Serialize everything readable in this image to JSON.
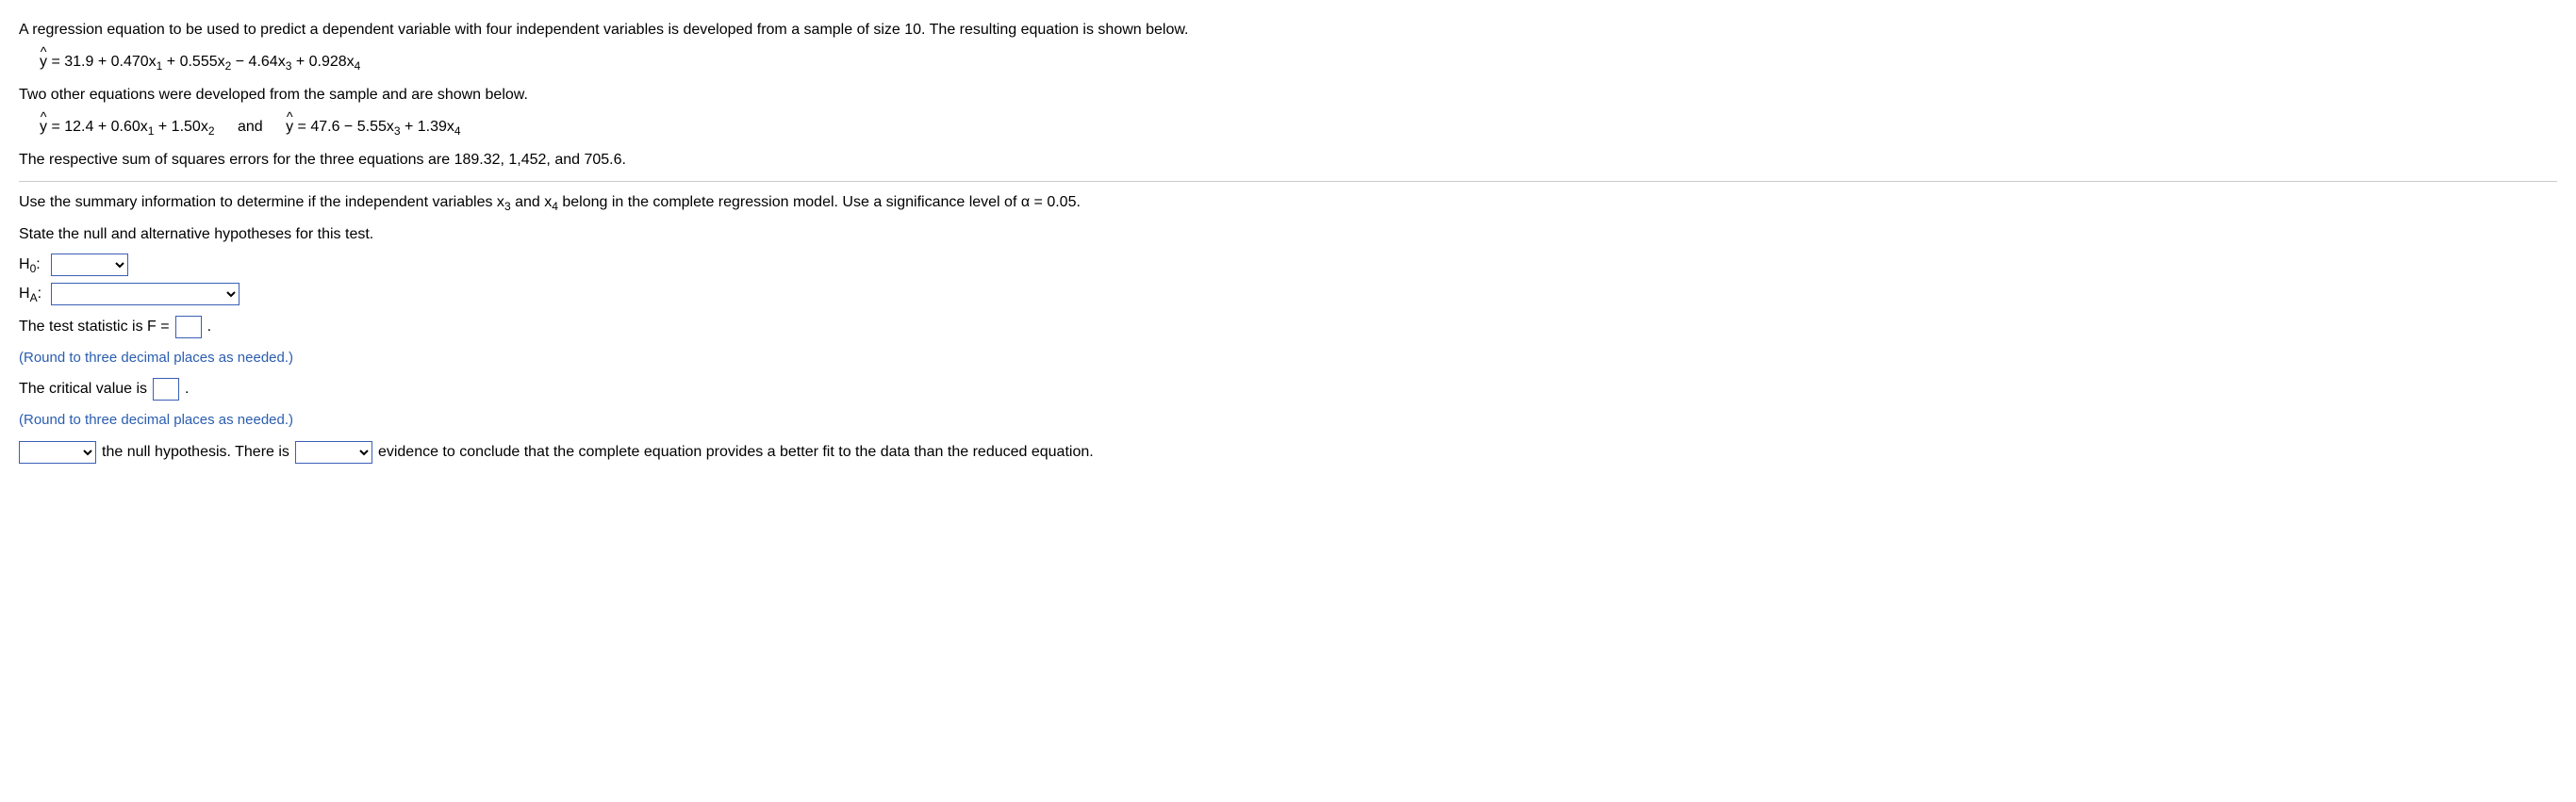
{
  "intro": "A regression equation to be used to predict a dependent variable with four independent variables is developed from a sample of size 10. The resulting equation is shown below.",
  "eq1": {
    "lhs": "y",
    "rhs_pre": " = 31.9 + 0.470x",
    "s1": "1",
    "p2": " + 0.555x",
    "s2": "2",
    "p3": " − 4.64x",
    "s3": "3",
    "p4": " + 0.928x",
    "s4": "4"
  },
  "two_other": "Two other equations were developed from the sample and are shown below.",
  "eq2a": {
    "rhs_pre": " = 12.4 + 0.60x",
    "s1": "1",
    "p2": " + 1.50x",
    "s2": "2"
  },
  "and_label": "and",
  "eq2b": {
    "rhs_pre": " = 47.6 − 5.55x",
    "s1": "3",
    "p2": " + 1.39x",
    "s2": "4"
  },
  "sse_line": "The respective sum of squares errors for the three equations are 189.32, 1,452, and 705.6.",
  "use_summary_pre": "Use the summary information to determine if the independent variables x",
  "use_summary_s1": "3",
  "use_summary_mid": " and x",
  "use_summary_s2": "4",
  "use_summary_post": " belong in the complete regression model. Use a significance level of α = 0.05.",
  "state_hyp": "State the null and alternative hypotheses for this test.",
  "H0_label": "H",
  "H0_sub": "0",
  "HA_label": "H",
  "HA_sub": "A",
  "colon": ":",
  "test_stat_pre": "The test statistic is F = ",
  "period": ".",
  "round_help": "(Round to three decimal places as needed.)",
  "crit_pre": "The critical value is ",
  "concl_mid1": " the null hypothesis. There is ",
  "concl_mid2": " evidence to conclude that the complete equation provides a better fit to the data than the reduced equation."
}
